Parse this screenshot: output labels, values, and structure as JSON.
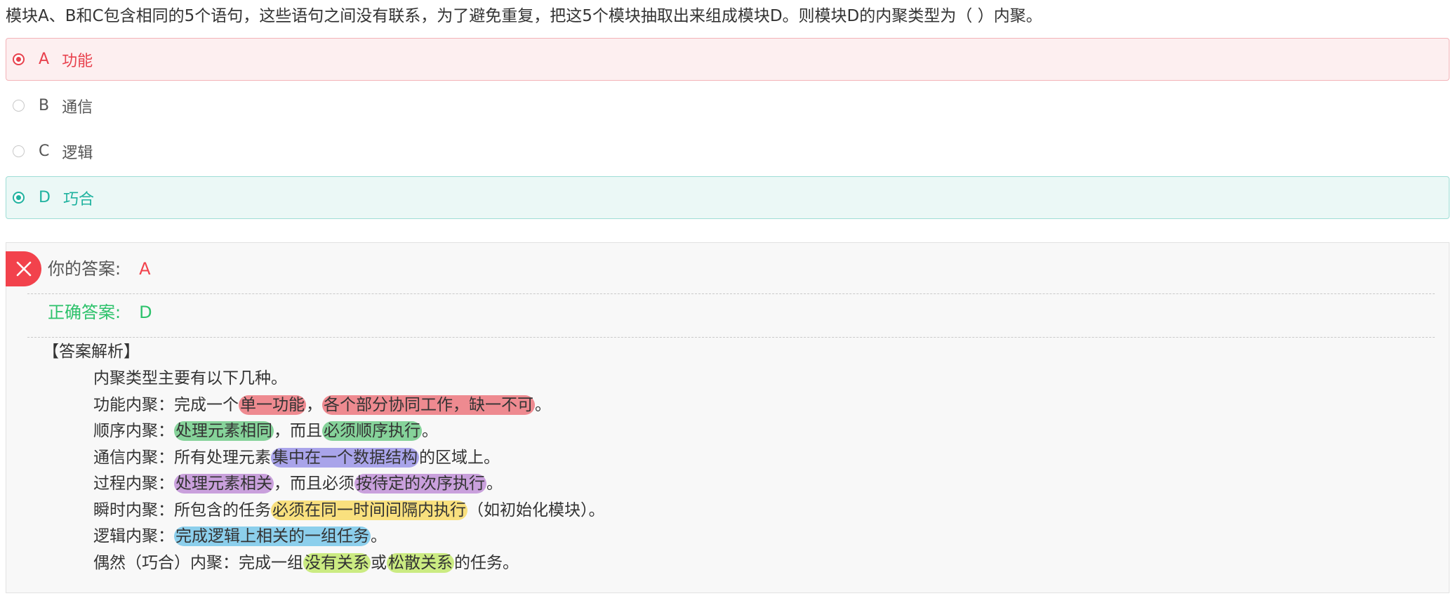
{
  "question": "模块A、B和C包含相同的5个语句，这些语句之间没有联系，为了避免重复，把这5个模块抽取出来组成模块D。则模块D的内聚类型为（ ）内聚。",
  "options": [
    {
      "letter": "A",
      "text": "功能",
      "state": "user-selected-wrong"
    },
    {
      "letter": "B",
      "text": "通信",
      "state": "normal"
    },
    {
      "letter": "C",
      "text": "逻辑",
      "state": "normal"
    },
    {
      "letter": "D",
      "text": "巧合",
      "state": "correct"
    }
  ],
  "result": {
    "your_label": "你的答案:",
    "your_value": "A",
    "correct_label": "正确答案:",
    "correct_value": "D"
  },
  "analysis": {
    "title": "【答案解析】",
    "intro": "内聚类型主要有以下几种。",
    "lines": {
      "functional": {
        "a": "功能内聚：完成一个",
        "h1": "单一功能",
        "b": "，",
        "h2": "各个部分协同工作，缺一不可",
        "c": "。"
      },
      "sequential": {
        "a": "顺序内聚：",
        "h1": "处理元素相同",
        "b": "，而且",
        "h2": "必须顺序执行",
        "c": "。"
      },
      "communicational": {
        "a": "通信内聚：所有处理元素",
        "h1": "集中在一个数据结构",
        "b": "的区域上。"
      },
      "procedural": {
        "a": "过程内聚：",
        "h1": "处理元素相关",
        "b": "，而且必须",
        "h2": "按待定的次序执行",
        "c": "。"
      },
      "temporal": {
        "a": "瞬时内聚：所包含的任务",
        "h1": "必须在同一时间间隔内执行",
        "b": "（如初始化模块）。"
      },
      "logical": {
        "a": "逻辑内聚：",
        "h1": "完成逻辑上相关的一组任务",
        "b": "。"
      },
      "coincidental": {
        "a": "偶然（巧合）内聚：完成一组",
        "h1": "没有关系",
        "b": "或",
        "h2": "松散关系",
        "c": "的任务。"
      }
    }
  },
  "colors": {
    "wrong": "#f2424c",
    "correct": "#2dc26b",
    "option_correct": "#1fb29f",
    "highlight_red": "#ee8a90",
    "highlight_green": "#86d39a",
    "highlight_blue": "#a9a4ea",
    "highlight_purple": "#c9a0dc",
    "highlight_yellow": "#f9e07e",
    "highlight_cyan": "#8ccfec",
    "highlight_lime": "#cbeb82"
  },
  "icons": {
    "wrong_badge": "close-icon",
    "selected_radio": "radio-checked-icon",
    "radio": "radio-icon"
  }
}
